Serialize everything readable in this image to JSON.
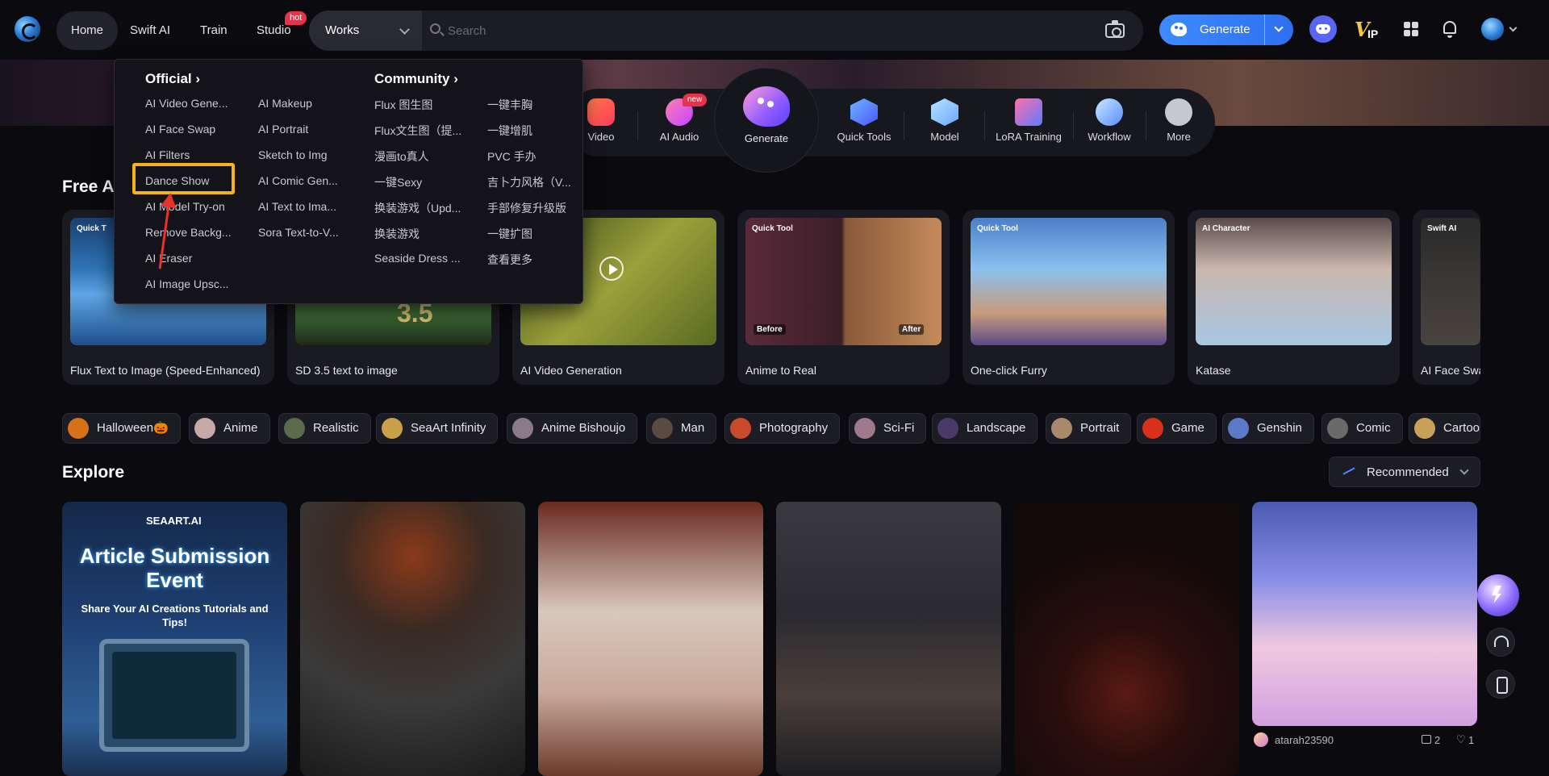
{
  "nav": {
    "items": [
      "Home",
      "Swift AI",
      "Train",
      "Studio"
    ],
    "hot_badge": "hot",
    "works_select": "Works",
    "search_placeholder": "Search",
    "generate_label": "Generate",
    "vip_v": "V",
    "vip_ip": "IP"
  },
  "menu": {
    "official_heading": "Official ›",
    "community_heading": "Community ›",
    "official_col1": [
      "AI Video Gene...",
      "AI Face Swap",
      "AI Filters",
      "Dance Show",
      "AI Model Try-on",
      "Remove Backg...",
      "AI Eraser",
      "AI Image Upsc..."
    ],
    "official_col2": [
      "AI Makeup",
      "AI Portrait",
      "Sketch to Img",
      "AI Comic Gen...",
      "AI Text to Ima...",
      "Sora Text-to-V..."
    ],
    "community_col1": [
      "Flux 图生图",
      "Flux文生图（提...",
      "漫画to真人",
      "一键Sexy",
      "换装游戏（Upd...",
      "换装游戏",
      "Seaside Dress ..."
    ],
    "community_col2": [
      "一键丰胸",
      "一键增肌",
      "PVC 手办",
      "吉卜力风格（V...",
      "手部修复升级版",
      "一键扩图",
      "查看更多"
    ]
  },
  "quickbar": {
    "items": [
      "Video",
      "AI Audio",
      "Quick Tools",
      "Model",
      "LoRA Training",
      "Workflow",
      "More"
    ],
    "new_badge": "new",
    "generate_label": "Generate"
  },
  "free_ai": {
    "title": "Free A",
    "cards": [
      {
        "tag": "Quick T",
        "caption": "Flux Text to Image (Speed-Enhanced)"
      },
      {
        "tag": "",
        "caption": "SD 3.5 text to image"
      },
      {
        "tag": "",
        "caption": "AI Video Generation"
      },
      {
        "tag": "Quick Tool",
        "caption": "Anime to Real"
      },
      {
        "tag": "Quick Tool",
        "caption": "One-click Furry"
      },
      {
        "tag": "AI Character",
        "caption": "Katase"
      },
      {
        "tag": "Swift AI",
        "caption": "AI Face Swa"
      }
    ],
    "before_label": "Before",
    "after_label": "After",
    "sd_badge": "3.5"
  },
  "chips": [
    "Halloween🎃",
    "Anime",
    "Realistic",
    "SeaArt Infinity",
    "Anime Bishoujo",
    "Man",
    "Photography",
    "Sci-Fi",
    "Landscape",
    "Portrait",
    "Game",
    "Genshin",
    "Comic",
    "Cartoo"
  ],
  "explore": {
    "title": "Explore",
    "sort_select": "Recommended",
    "poster_brand": "SEAART.AI",
    "poster_title": "Article Submission Event",
    "poster_subtitle": "Share Your AI Creations Tutorials and Tips!",
    "user": {
      "name": "atarah23590",
      "likes": "2",
      "hearts": "1"
    }
  },
  "colors": {
    "accent": "#2e6ff0",
    "highlight_box": "#f5b21a",
    "arrow": "#e8322a",
    "hot_badge": "#e6324b"
  }
}
